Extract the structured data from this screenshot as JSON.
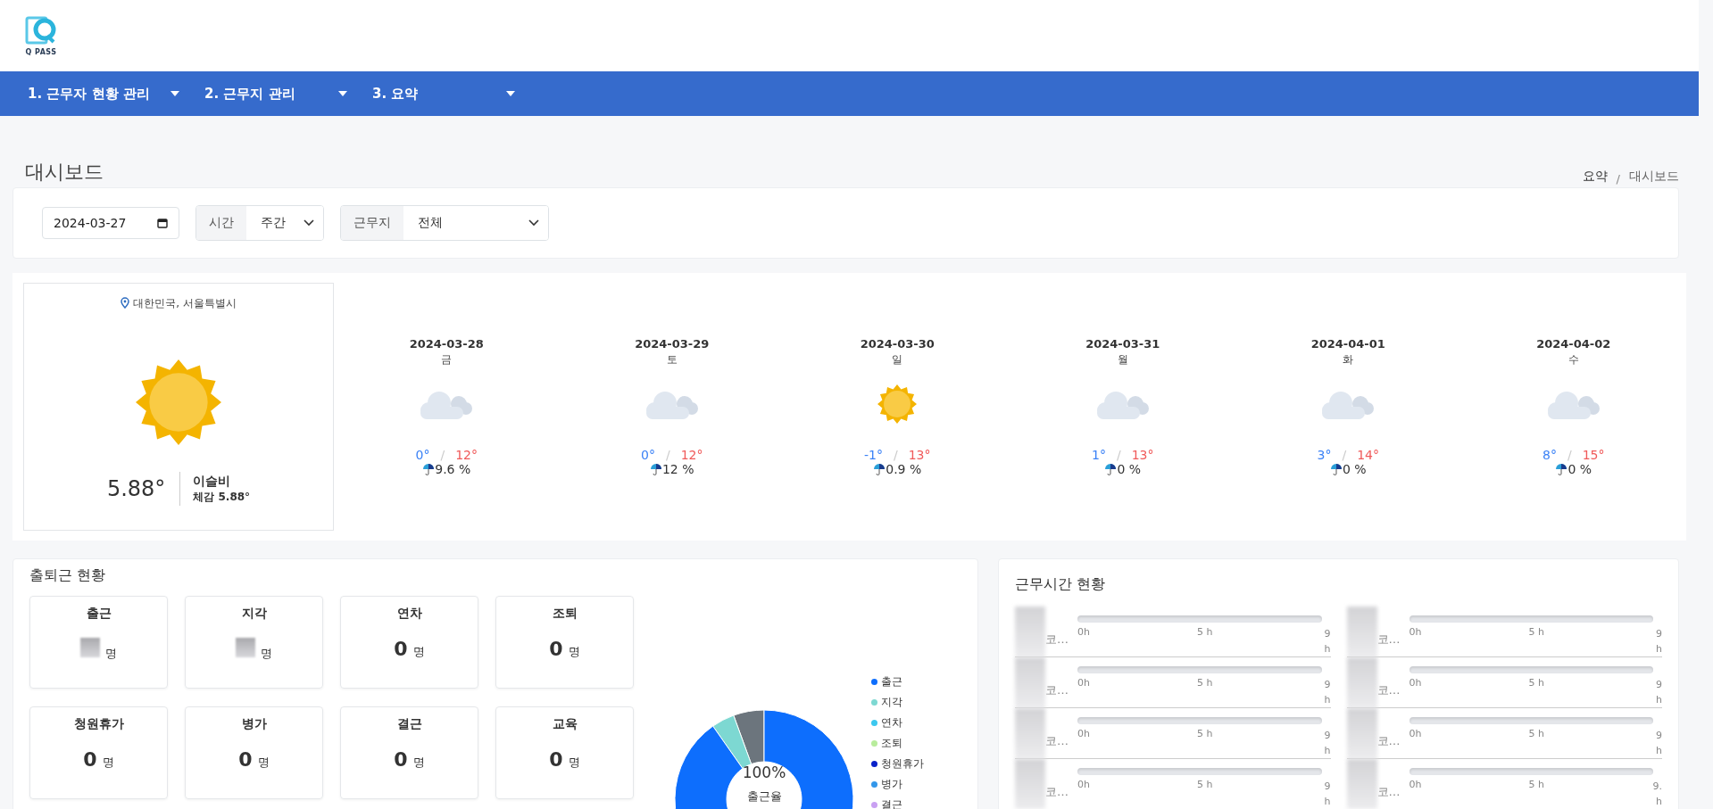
{
  "logo": {
    "text": "Q PASS"
  },
  "nav": [
    {
      "label": "1. 근무자 현황 관리"
    },
    {
      "label": "2. 근무지 관리"
    },
    {
      "label": "3. 요약"
    }
  ],
  "page_title": "대시보드",
  "breadcrumb": {
    "items": [
      "요약",
      "대시보드"
    ],
    "separator": "/"
  },
  "filters": {
    "date": "2024-03-27",
    "time": {
      "label": "시간",
      "value": "주간"
    },
    "site": {
      "label": "근무지",
      "value": "전체"
    }
  },
  "current_weather": {
    "location": "대한민국, 서울특별시",
    "kind": "sun",
    "temp": "5.88°",
    "description": "이슬비",
    "feels": "체감 5.88°"
  },
  "forecast": [
    {
      "date": "2024-03-28",
      "weekday": "금",
      "kind": "cloud",
      "low": "0°",
      "separator": "/",
      "high": "12°",
      "rain": "9.6 %"
    },
    {
      "date": "2024-03-29",
      "weekday": "토",
      "kind": "cloud",
      "low": "0°",
      "separator": "/",
      "high": "12°",
      "rain": "12 %"
    },
    {
      "date": "2024-03-30",
      "weekday": "일",
      "kind": "sun",
      "low": "-1°",
      "separator": "/",
      "high": "13°",
      "rain": "0.9 %"
    },
    {
      "date": "2024-03-31",
      "weekday": "월",
      "kind": "cloud",
      "low": "1°",
      "separator": "/",
      "high": "13°",
      "rain": "0 %"
    },
    {
      "date": "2024-04-01",
      "weekday": "화",
      "kind": "cloud",
      "low": "3°",
      "separator": "/",
      "high": "14°",
      "rain": "0 %"
    },
    {
      "date": "2024-04-02",
      "weekday": "수",
      "kind": "cloud",
      "low": "8°",
      "separator": "/",
      "high": "15°",
      "rain": "0 %"
    }
  ],
  "attendance": {
    "title": "출퇴근 현황",
    "cards": [
      {
        "label": "출근",
        "unit": "명",
        "redacted": true
      },
      {
        "label": "지각",
        "unit": "명",
        "redacted": true
      },
      {
        "label": "연차",
        "count": "0",
        "unit": "명",
        "redacted": false
      },
      {
        "label": "조퇴",
        "count": "0",
        "unit": "명",
        "redacted": false
      },
      {
        "label": "청원휴가",
        "count": "0",
        "unit": "명",
        "redacted": false
      },
      {
        "label": "병가",
        "count": "0",
        "unit": "명",
        "redacted": false
      },
      {
        "label": "결근",
        "count": "0",
        "unit": "명",
        "redacted": false
      },
      {
        "label": "교육",
        "count": "0",
        "unit": "명",
        "redacted": false
      }
    ],
    "donut": {
      "value": "100%",
      "caption": "출근율"
    },
    "legend": [
      {
        "label": "출근",
        "color": "#0d6efd"
      },
      {
        "label": "지각",
        "color": "#7dd8d2"
      },
      {
        "label": "연차",
        "color": "#3cc8ef"
      },
      {
        "label": "조퇴",
        "color": "#b8ec9c"
      },
      {
        "label": "청원휴가",
        "color": "#0a22c9"
      },
      {
        "label": "병가",
        "color": "#3397ea"
      },
      {
        "label": "결근",
        "color": "#c9a0f2"
      }
    ]
  },
  "work_hours": {
    "title": "근무시간 현황",
    "rows": [
      {
        "suffix": "코…",
        "level": 0,
        "ticks": [
          "0h",
          "5 h",
          "9 h"
        ]
      },
      {
        "suffix": "코…",
        "level": 0,
        "ticks": [
          "0h",
          "5 h",
          "9 h"
        ]
      },
      {
        "suffix": "코…",
        "level": 0,
        "ticks": [
          "0h",
          "5 h",
          "9 h"
        ]
      },
      {
        "suffix": "코…",
        "level": 0,
        "ticks": [
          "0h",
          "5 h",
          "9 h"
        ]
      },
      {
        "suffix": "코…",
        "level": 0,
        "ticks": [
          "0h",
          "5 h",
          "9 h"
        ]
      },
      {
        "suffix": "코…",
        "level": 0,
        "ticks": [
          "0h",
          "5 h",
          "9 h"
        ]
      },
      {
        "suffix": "코…",
        "level": 0,
        "ticks": [
          "0h",
          "5 h",
          "9 h"
        ]
      },
      {
        "suffix": "코…",
        "level": 0,
        "ticks": [
          "0h",
          "5 h",
          "9. h"
        ]
      }
    ]
  }
}
